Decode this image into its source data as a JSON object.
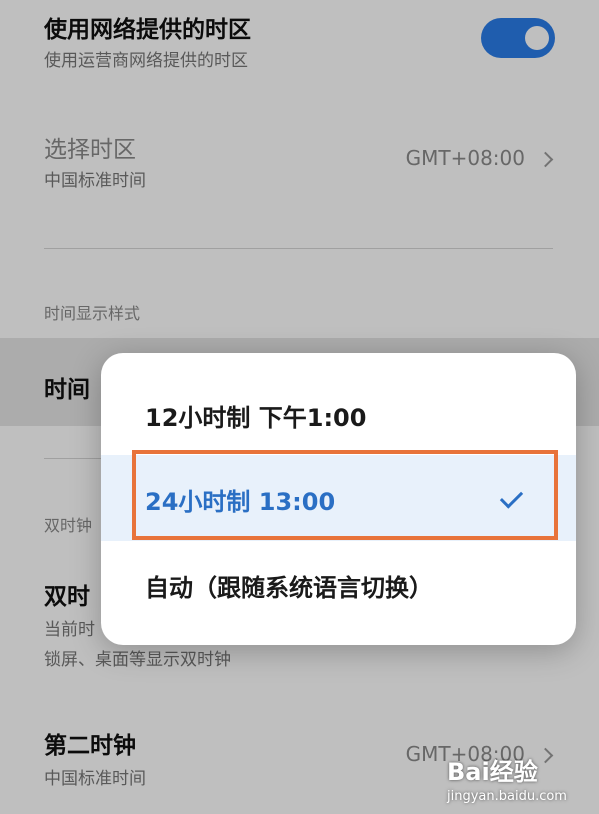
{
  "network_timezone": {
    "title": "使用网络提供的时区",
    "subtitle": "使用运营商网络提供的时区",
    "toggle_on": true
  },
  "select_timezone": {
    "title": "选择时区",
    "subtitle": "中国标准时间",
    "value": "GMT+08:00"
  },
  "section_time_format": "时间显示样式",
  "time_format_row": {
    "title_visible": "时间"
  },
  "section_dual_clock": "双时钟",
  "dual_clock_row": {
    "title_visible": "双时",
    "subtitle_line1_visible": "当前时",
    "subtitle_line2": "锁屏、桌面等显示双时钟"
  },
  "second_clock": {
    "title": "第二时钟",
    "subtitle": "中国标准时间",
    "value": "GMT+08:00"
  },
  "popup": {
    "options": [
      {
        "label": "12小时制 下午1:00",
        "selected": false
      },
      {
        "label": "24小时制 13:00",
        "selected": true
      },
      {
        "label": "自动（跟随系统语言切换）",
        "selected": false
      }
    ]
  },
  "colors": {
    "accent": "#2a7de9",
    "selected_text": "#2a6fc4",
    "annotation": "#e8733a"
  },
  "watermark": {
    "brand": "Bai经验",
    "url": "jingyan.baidu.com"
  }
}
